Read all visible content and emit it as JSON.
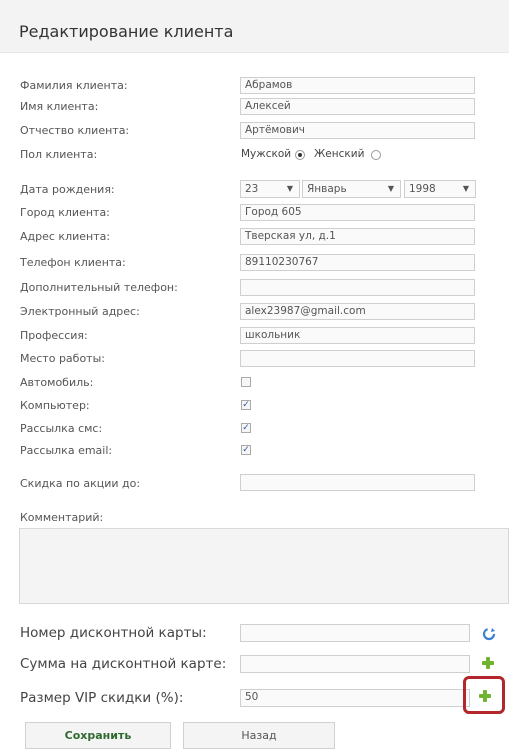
{
  "page": {
    "title": "Редактирование клиента"
  },
  "fields": {
    "last_name": {
      "label": "Фамилия клиента:",
      "value": "Абрамов"
    },
    "first_name": {
      "label": "Имя клиента:",
      "value": "Алексей"
    },
    "patronymic": {
      "label": "Отчество клиента:",
      "value": "Артёмович"
    },
    "gender": {
      "label": "Пол клиента:",
      "male": "Мужской",
      "female": "Женский",
      "selected": "Мужской"
    },
    "birth_date": {
      "label": "Дата рождения:",
      "day": "23",
      "month": "Январь",
      "year": "1998"
    },
    "city": {
      "label": "Город клиента:",
      "value": "Город 605"
    },
    "address": {
      "label": "Адрес клиента:",
      "value": "Тверская ул, д.1"
    },
    "phone": {
      "label": "Телефон клиента:",
      "value": "89110230767"
    },
    "extra_phone": {
      "label": "Дополнительный телефон:",
      "value": ""
    },
    "email": {
      "label": "Электронный адрес:",
      "value": "alex23987@gmail.com"
    },
    "profession": {
      "label": "Профессия:",
      "value": "школьник"
    },
    "workplace": {
      "label": "Место работы:",
      "value": ""
    },
    "car": {
      "label": "Автомобиль:",
      "checked": false
    },
    "computer": {
      "label": "Компьютер:",
      "checked": true
    },
    "sms": {
      "label": "Рассылка смс:",
      "checked": true
    },
    "email_sub": {
      "label": "Рассылка email:",
      "checked": true
    },
    "discount_until": {
      "label": "Скидка по акции до:",
      "value": ""
    },
    "comment": {
      "label": "Комментарий:",
      "value": ""
    }
  },
  "card": {
    "number": {
      "label": "Номер дисконтной карты:",
      "value": ""
    },
    "sum": {
      "label": "Сумма на дисконтной карте:",
      "value": ""
    },
    "vip": {
      "label": "Размер VIP скидки (%):",
      "value": "50"
    }
  },
  "buttons": {
    "save": "Сохранить",
    "back": "Назад"
  },
  "icons": {
    "plus": "plus-icon",
    "refresh": "refresh-icon"
  },
  "colors": {
    "highlight": "#b3272c",
    "plus": "#6fb32e",
    "check": "#2c5b9a"
  }
}
